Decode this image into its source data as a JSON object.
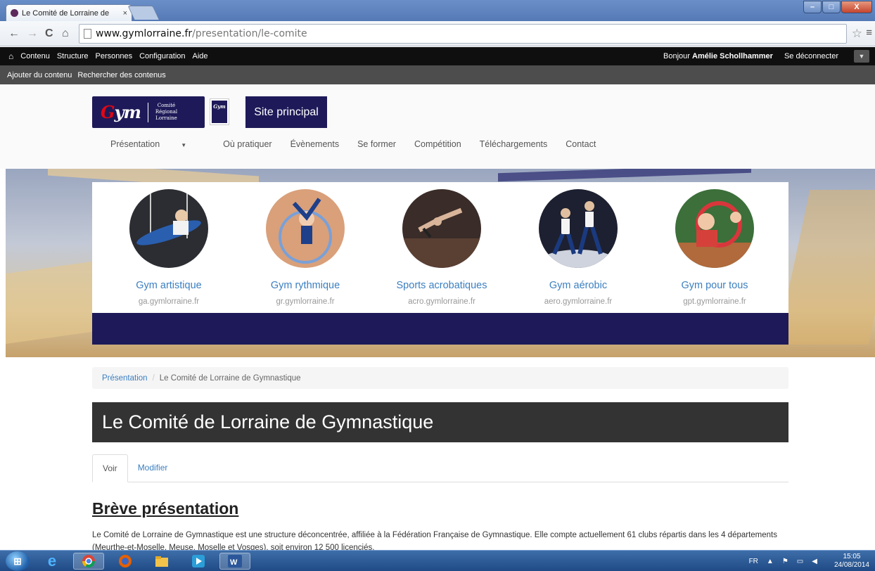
{
  "browser": {
    "tab_title": "Le Comité de Lorraine de",
    "tab_close": "×",
    "url_host": "www.gymlorraine.fr",
    "url_path": "/presentation/le-comite",
    "window_buttons": {
      "minimize": "–",
      "maximize": "□",
      "close": "X"
    }
  },
  "admin_toolbar": {
    "items": [
      "Contenu",
      "Structure",
      "Personnes",
      "Configuration",
      "Aide"
    ],
    "greeting": "Bonjour",
    "user": "Amélie Schollhammer",
    "logout": "Se déconnecter",
    "shortcuts": [
      "Ajouter du contenu",
      "Rechercher des contenus"
    ]
  },
  "header": {
    "logo_text": "Gym",
    "logo_region": [
      "Comité",
      "Régional",
      "Lorraine"
    ],
    "site_button": "Site principal",
    "nav": [
      "Présentation",
      "Où pratiquer",
      "Évènements",
      "Se former",
      "Compétition",
      "Téléchargements",
      "Contact"
    ]
  },
  "disciplines": [
    {
      "name": "Gym artistique",
      "domain": "ga.gymlorraine.fr"
    },
    {
      "name": "Gym rythmique",
      "domain": "gr.gymlorraine.fr"
    },
    {
      "name": "Sports acrobatiques",
      "domain": "acro.gymlorraine.fr"
    },
    {
      "name": "Gym aérobic",
      "domain": "aero.gymlorraine.fr"
    },
    {
      "name": "Gym pour tous",
      "domain": "gpt.gymlorraine.fr"
    }
  ],
  "breadcrumb": {
    "link": "Présentation",
    "divider": "/",
    "current": "Le Comité de Lorraine de Gymnastique"
  },
  "page_title": "Le Comité de Lorraine de Gymnastique",
  "tabs": [
    "Voir",
    "Modifier"
  ],
  "section": {
    "heading": "Brève présentation",
    "paragraph": "Le Comité de Lorraine de Gymnastique est une structure déconcentrée, affiliée à la Fédération Française de Gymnastique. Elle compte actuellement 61 clubs répartis dans les 4 départements (Meurthe-et-Moselle, Meuse, Moselle et Vosges), soit environ 12 500 licenciés."
  },
  "taskbar": {
    "lang": "FR",
    "time": "15:05",
    "date": "24/08/2014"
  },
  "colors": {
    "navy": "#1e1a59",
    "link": "#3b7fc0",
    "title_bg": "#333333"
  }
}
